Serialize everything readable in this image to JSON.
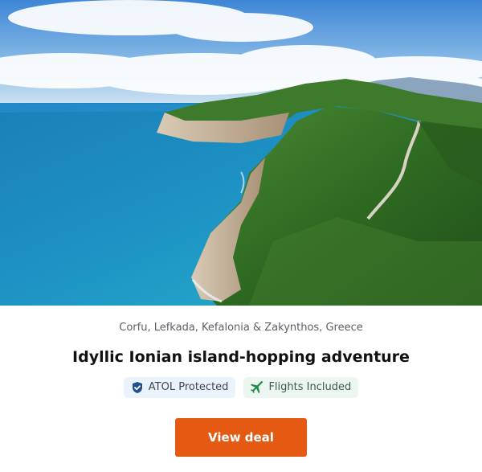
{
  "deal": {
    "image_alt": "Aerial view of a green cliffside peninsula above turquoise sea",
    "location": "Corfu, Lefkada, Kefalonia & Zakynthos, Greece",
    "title": "Idyllic Ionian island-hopping adventure",
    "badges": [
      {
        "icon": "shield-check-icon",
        "label": "ATOL Protected"
      },
      {
        "icon": "airplane-icon",
        "label": "Flights Included"
      }
    ],
    "cta_label": "View deal"
  },
  "colors": {
    "cta": "#e45a13",
    "atol_bg": "#eaf3fb",
    "atol_icon": "#1f4f8f",
    "flights_bg": "#eaf6ef",
    "flights_icon": "#1f8a4c"
  }
}
